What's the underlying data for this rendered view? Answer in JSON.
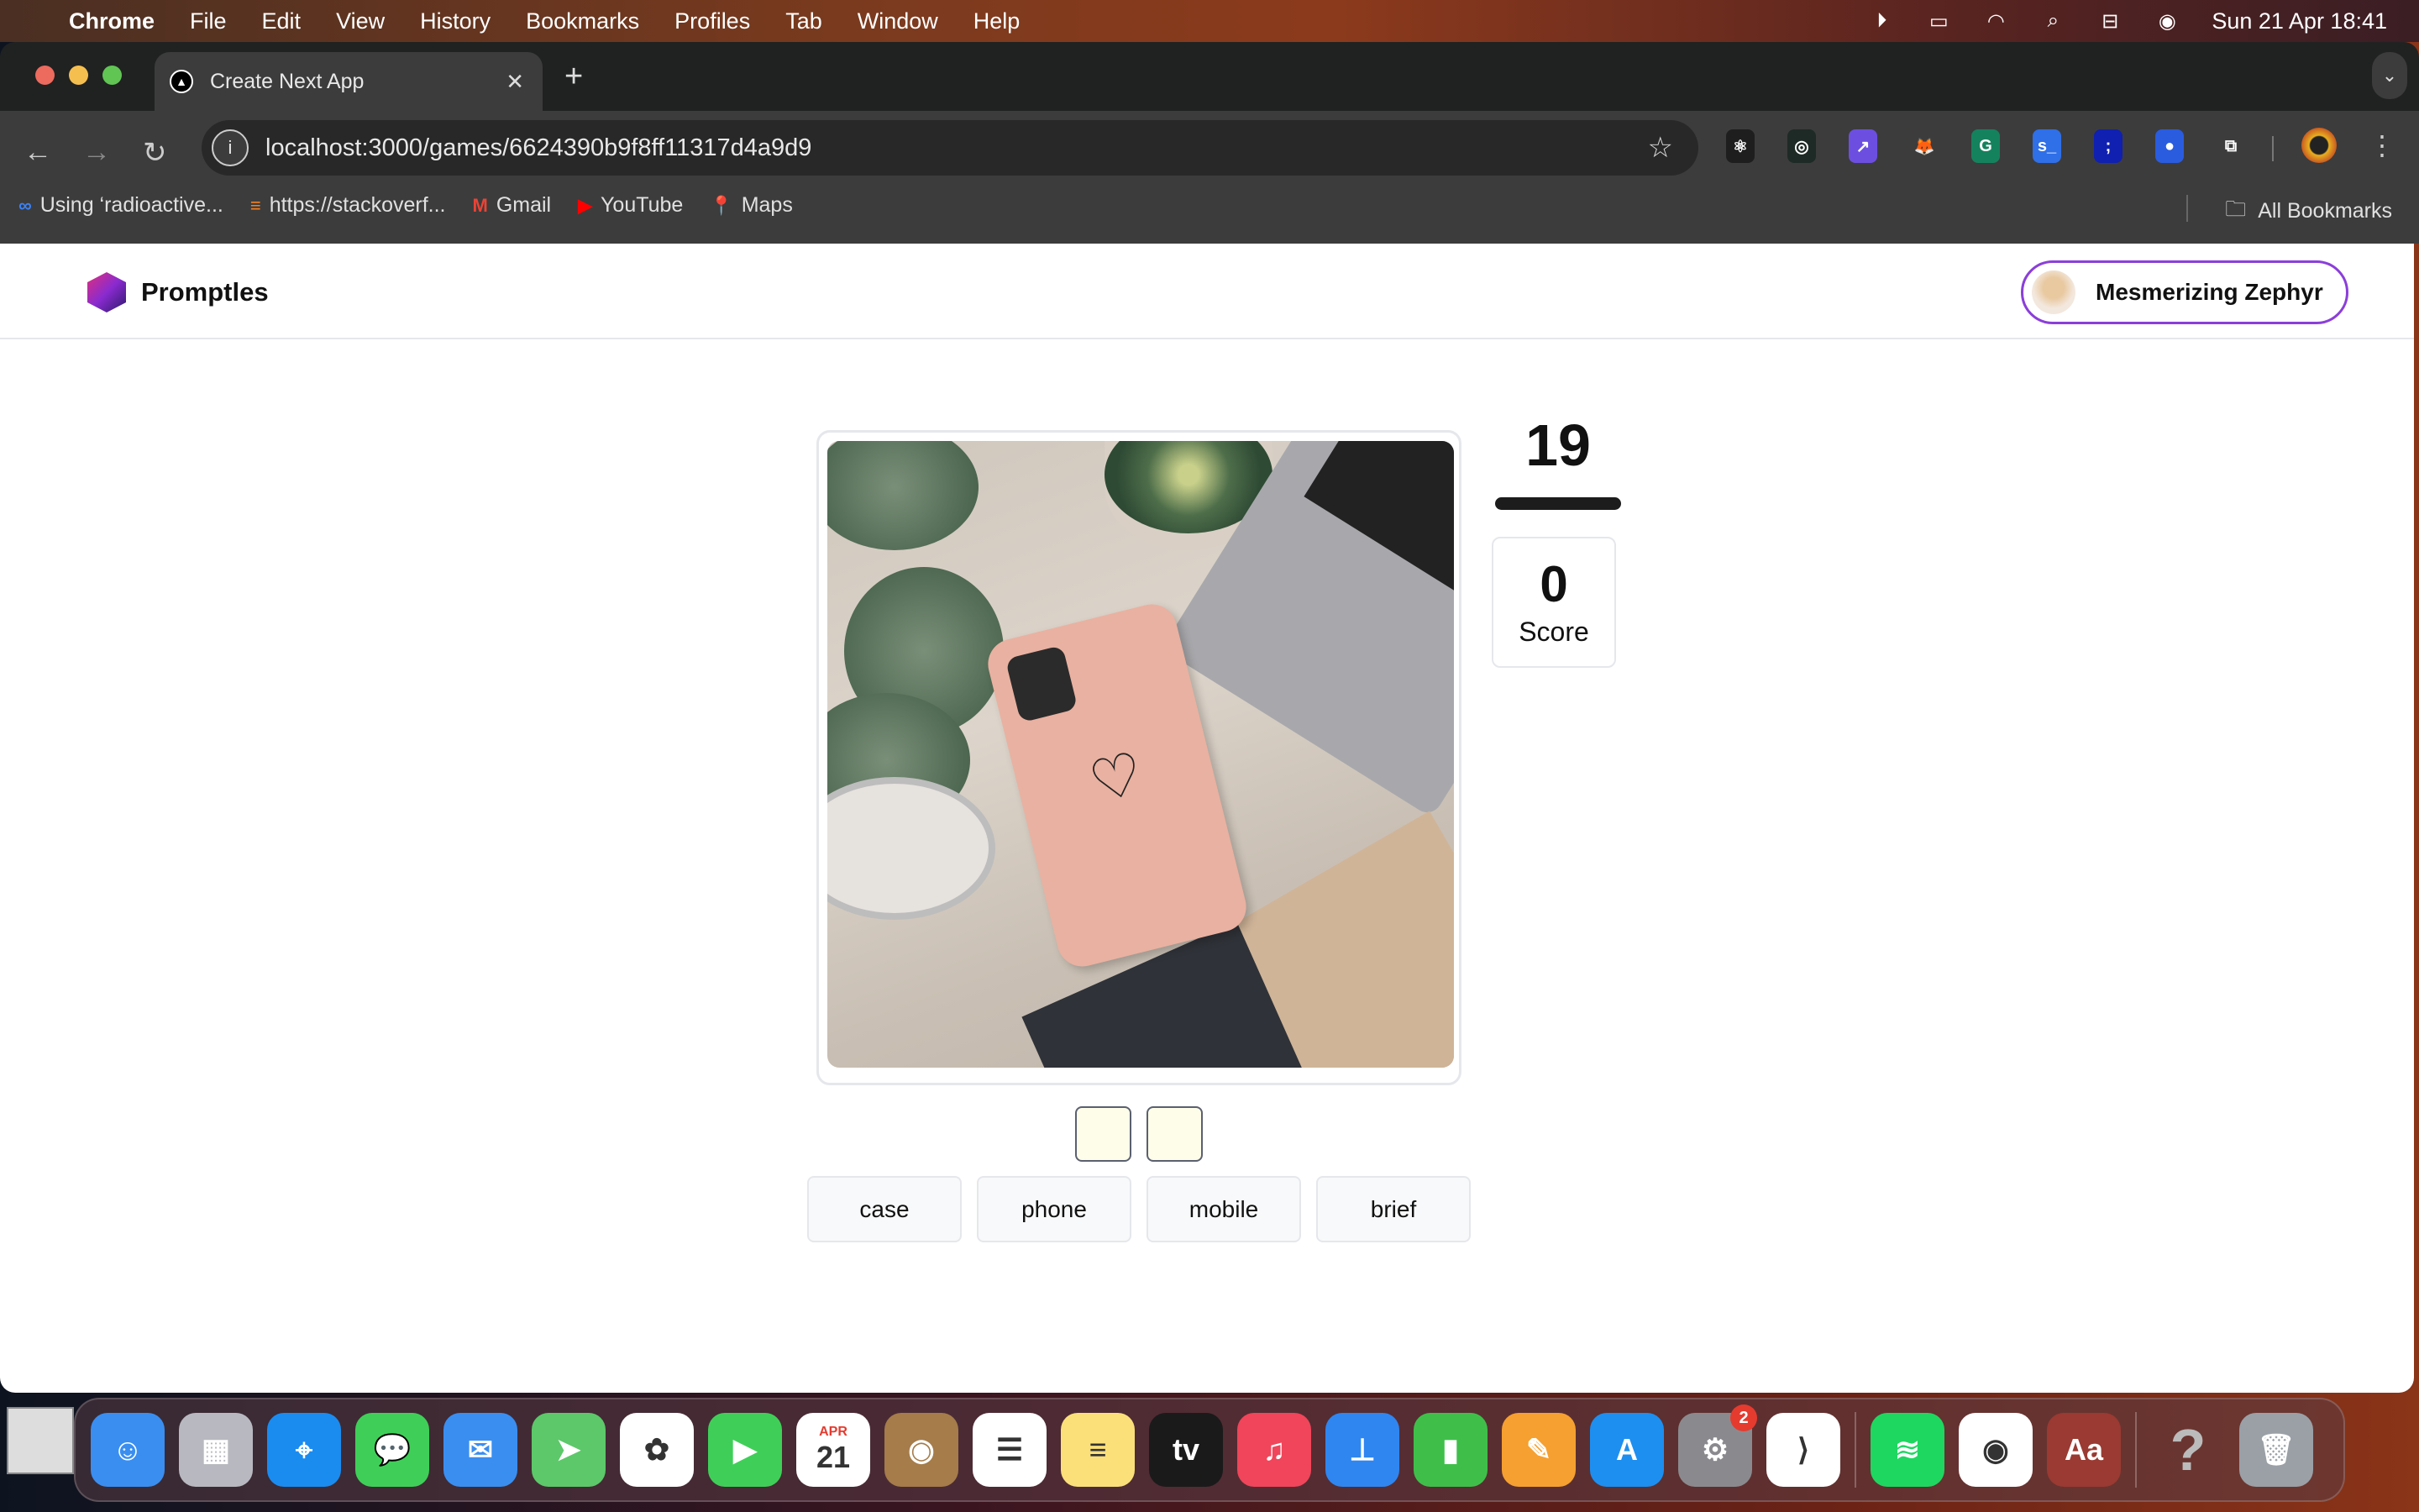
{
  "menubar": {
    "app": "Chrome",
    "items": [
      "File",
      "Edit",
      "View",
      "History",
      "Bookmarks",
      "Profiles",
      "Tab",
      "Window",
      "Help"
    ],
    "datetime": "Sun 21 Apr  18:41",
    "status_icons": [
      "play-icon",
      "battery-icon",
      "wifi-icon",
      "search-icon",
      "control-center-icon",
      "siri-icon"
    ]
  },
  "browser": {
    "tab_title": "Create Next App",
    "url": "localhost:3000/games/6624390b9f8ff11317d4a9d9",
    "extensions": [
      {
        "name": "react-devtools",
        "color": "#1e1e1e",
        "glyph": "⚛"
      },
      {
        "name": "extension-green-circle",
        "color": "#1d2a25",
        "glyph": "◎"
      },
      {
        "name": "extension-purple",
        "color": "#6c4fe0",
        "glyph": "↗"
      },
      {
        "name": "metamask",
        "color": "#3c3c3c",
        "glyph": "🦊"
      },
      {
        "name": "grammarly",
        "color": "#15825e",
        "glyph": "G"
      },
      {
        "name": "extension-blue-s",
        "color": "#2f6fe8",
        "glyph": "s_"
      },
      {
        "name": "extension-semicolon",
        "color": "#1020b0",
        "glyph": ";"
      },
      {
        "name": "extension-blue-dot",
        "color": "#2a5ce0",
        "glyph": "●"
      },
      {
        "name": "extensions-puzzle",
        "color": "#3c3c3c",
        "glyph": "⧉"
      }
    ],
    "bookmarks": [
      {
        "label": "Using ‘radioactive...",
        "icon": "meta-icon",
        "glyph": "∞",
        "color": "#3b82f6"
      },
      {
        "label": "https://stackoverf...",
        "icon": "stackoverflow-icon",
        "glyph": "≡",
        "color": "#f48024"
      },
      {
        "label": "Gmail",
        "icon": "gmail-icon",
        "glyph": "M",
        "color": "#ea4335"
      },
      {
        "label": "YouTube",
        "icon": "youtube-icon",
        "glyph": "▶",
        "color": "#ff0000"
      },
      {
        "label": "Maps",
        "icon": "maps-icon",
        "glyph": "📍",
        "color": "#34a853"
      }
    ],
    "all_bookmarks": "All Bookmarks"
  },
  "app": {
    "brand": "Promptles",
    "user": "Mesmerizing Zephyr",
    "accent": "#8b3fd9",
    "timer": "19",
    "score": {
      "value": "0",
      "label": "Score"
    },
    "answer_slots": 2,
    "words": [
      "case",
      "phone",
      "mobile",
      "brief"
    ]
  },
  "dock": [
    {
      "name": "finder",
      "color": "#3a8ef0",
      "glyph": "☺"
    },
    {
      "name": "launchpad",
      "color": "#b8b8c0",
      "glyph": "▦"
    },
    {
      "name": "safari",
      "color": "#1a8cf0",
      "glyph": "⌖"
    },
    {
      "name": "messages",
      "color": "#3fcf58",
      "glyph": "💬"
    },
    {
      "name": "mail",
      "color": "#3a8ef0",
      "glyph": "✉"
    },
    {
      "name": "maps",
      "color": "#5cc86a",
      "glyph": "➤"
    },
    {
      "name": "photos",
      "color": "#ffffff",
      "glyph": "✿"
    },
    {
      "name": "facetime",
      "color": "#3fcf58",
      "glyph": "▶"
    },
    {
      "name": "calendar",
      "color": "#ffffff",
      "glyph": "21",
      "month": "APR"
    },
    {
      "name": "contacts",
      "color": "#a57c4a",
      "glyph": "◉"
    },
    {
      "name": "reminders",
      "color": "#ffffff",
      "glyph": "☰"
    },
    {
      "name": "notes",
      "color": "#fbe07a",
      "glyph": "≡"
    },
    {
      "name": "apple-tv",
      "color": "#1a1a1a",
      "glyph": "tv"
    },
    {
      "name": "music",
      "color": "#f0455a",
      "glyph": "♫"
    },
    {
      "name": "keynote",
      "color": "#2f86f0",
      "glyph": "⊥"
    },
    {
      "name": "numbers",
      "color": "#3fbf4a",
      "glyph": "▮"
    },
    {
      "name": "pages",
      "color": "#f5a030",
      "glyph": "✎"
    },
    {
      "name": "app-store",
      "color": "#1d8ff0",
      "glyph": "A"
    },
    {
      "name": "system-settings",
      "color": "#8a8a8e",
      "glyph": "⚙",
      "badge": "2"
    },
    {
      "name": "vscode",
      "color": "#ffffff",
      "glyph": "⟩"
    },
    {
      "name": "spotify",
      "color": "#1ed760",
      "glyph": "≋"
    },
    {
      "name": "chrome",
      "color": "#ffffff",
      "glyph": "◉"
    },
    {
      "name": "dictionary",
      "color": "#9a3a32",
      "glyph": "Aa"
    },
    {
      "name": "help",
      "color": "transparent",
      "glyph": "?"
    },
    {
      "name": "trash",
      "color": "#9aa0a6",
      "glyph": "🗑"
    }
  ]
}
